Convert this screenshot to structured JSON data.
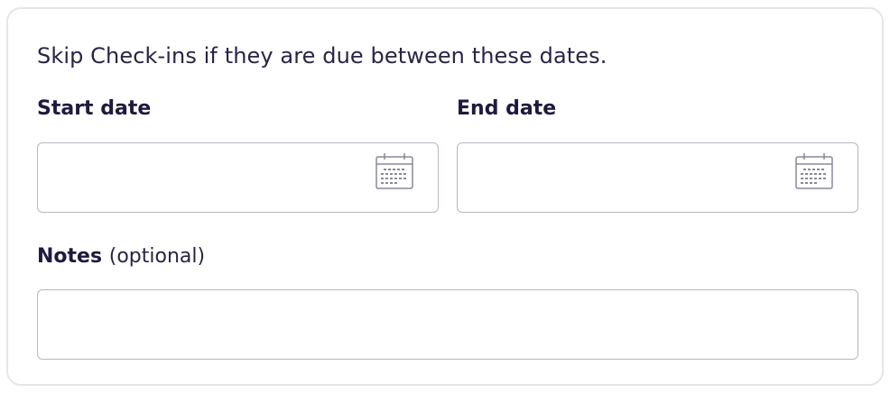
{
  "form": {
    "intro_text": "Skip Check-ins if they are due between these dates.",
    "start_date": {
      "label": "Start date",
      "value": "",
      "icon": "calendar-icon"
    },
    "end_date": {
      "label": "End date",
      "value": "",
      "icon": "calendar-icon"
    },
    "notes": {
      "label": "Notes",
      "optional_label": "(optional)",
      "value": ""
    }
  },
  "colors": {
    "text_dark": "#1f1a3d",
    "border": "#b8b6c4",
    "card_border": "#e6e6ea",
    "icon": "#8a8896"
  }
}
